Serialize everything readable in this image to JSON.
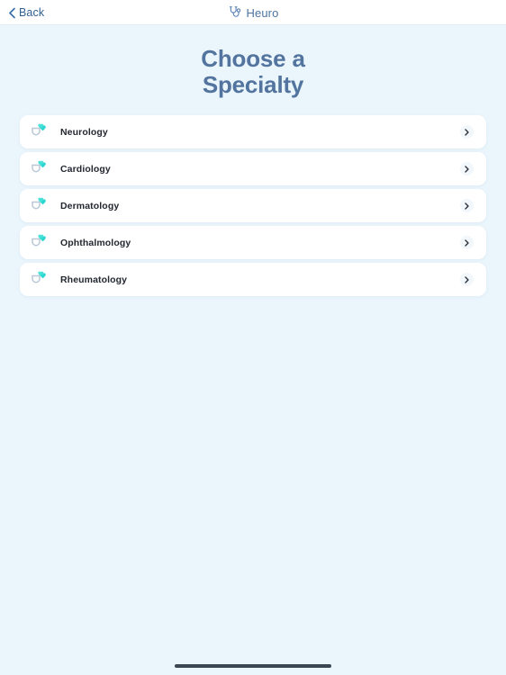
{
  "nav": {
    "back_label": "Back",
    "back_icon": "chevron-left-icon",
    "brand_name": "Heuro",
    "brand_icon": "stethoscope-icon"
  },
  "page": {
    "title_line_1": "Choose a",
    "title_line_2": "Specialty",
    "title_color": "#53749e"
  },
  "specialties": [
    {
      "label": "Neurology",
      "icon": "stethoscope-heart-icon",
      "chevron": "chevron-right-icon"
    },
    {
      "label": "Cardiology",
      "icon": "stethoscope-heart-icon",
      "chevron": "chevron-right-icon"
    },
    {
      "label": "Dermatology",
      "icon": "stethoscope-heart-icon",
      "chevron": "chevron-right-icon"
    },
    {
      "label": "Ophthalmology",
      "icon": "stethoscope-heart-icon",
      "chevron": "chevron-right-icon"
    },
    {
      "label": "Rheumatology",
      "icon": "stethoscope-heart-icon",
      "chevron": "chevron-right-icon"
    }
  ],
  "theme": {
    "background": "#eaf5fc",
    "card": "#ffffff",
    "accent_teal": "#2fd6cf",
    "accent_blue": "#5580b5",
    "text_dark": "#232730"
  },
  "home_indicator": {
    "visible": true
  }
}
